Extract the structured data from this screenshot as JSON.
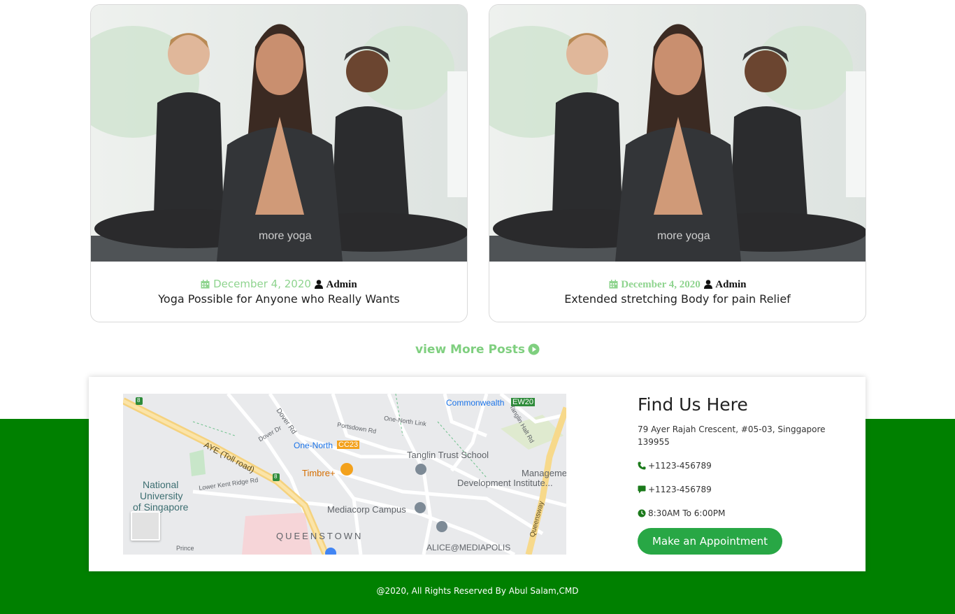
{
  "posts": [
    {
      "date": "December 4, 2020",
      "author": "Admin",
      "title": "Yoga Possible for Anyone who Really Wants"
    },
    {
      "date": "December 4, 2020",
      "author": "Admin",
      "title": "Extended stretching Body for pain Relief"
    }
  ],
  "view_more_label": "view More Posts",
  "map": {
    "labels": {
      "commonwealth": "Commonwealth",
      "ew20": "EW20",
      "one_north": "One-North",
      "cc23": "CC23",
      "tanglin": "Tanglin Trust School",
      "timbre": "Timbre+",
      "management": "Management",
      "development": "Development Institute...",
      "nus1": "National",
      "nus2": "University",
      "nus3": "of Singapore",
      "aye": "AYE (Toll road)",
      "mediacorp": "Mediacorp Campus",
      "queenstown": "QUEENSTOWN",
      "alice": "ALICE@MEDIAPOLIS",
      "dover": "Dover Rd",
      "portsdown": "Portsdown Rd",
      "one_north_link": "One-North Link",
      "queensway": "Queensway",
      "lower_kent": "Lower Kent Ridge Rd",
      "tanglin_halt": "Tanglin Halt Rd",
      "dover_dr": "Dover Dr",
      "prince": "Prince",
      "pin_8a": "8",
      "pin_8b": "8"
    }
  },
  "contact": {
    "title": "Find Us Here",
    "address": "79 Ayer Rajah Crescent, #05-03, Singgapore 139955",
    "phone": "+1123-456789",
    "message": "+1123-456789",
    "hours": "8:30AM To 6:00PM",
    "appointment_label": "Make an Appointment"
  },
  "footer": {
    "copyright": "@2020, All Rights Reserved By Abul Salam,CMD"
  },
  "colors": {
    "brand_green": "#008000",
    "button_green": "#28a745",
    "accent_light_green": "#8fd48f"
  }
}
